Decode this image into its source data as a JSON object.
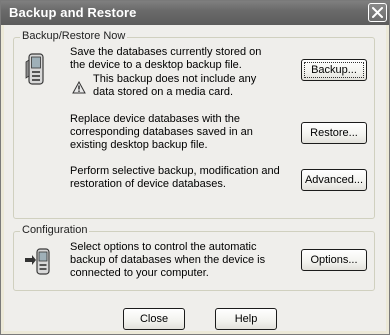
{
  "window": {
    "title": "Backup and Restore"
  },
  "backup_restore": {
    "group_label": "Backup/Restore Now",
    "backup_desc": "Save the databases currently stored on the device to a desktop backup file.",
    "warning_text": "This backup does not include any data stored on a media card.",
    "backup_button": "Backup...",
    "restore_desc": "Replace device databases with the corresponding databases saved in an existing desktop backup file.",
    "restore_button": "Restore...",
    "advanced_desc": "Perform selective backup, modification and restoration of device databases.",
    "advanced_button": "Advanced..."
  },
  "configuration": {
    "group_label": "Configuration",
    "options_desc": "Select options to control the automatic backup of databases when the device is connected to your computer.",
    "options_button": "Options..."
  },
  "footer": {
    "close_button": "Close",
    "help_button": "Help"
  },
  "icons": {
    "device": "handheld-device-icon",
    "warning": "warning-icon",
    "sync": "device-sync-icon",
    "close": "close-icon"
  }
}
